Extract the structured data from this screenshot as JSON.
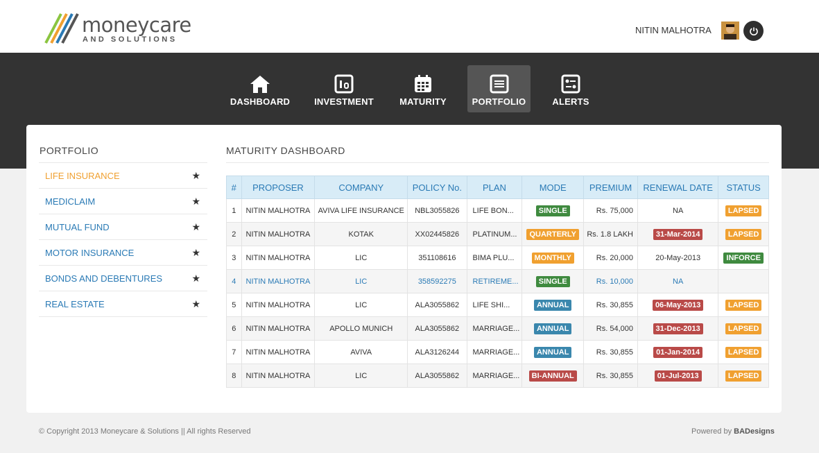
{
  "brand": {
    "name": "moneycare",
    "sub": "AND SOLUTIONS"
  },
  "user": {
    "name": "NITIN MALHOTRA"
  },
  "nav": [
    {
      "label": "DASHBOARD",
      "icon": "home-icon"
    },
    {
      "label": "INVESTMENT",
      "icon": "investment-icon"
    },
    {
      "label": "MATURITY",
      "icon": "calendar-icon"
    },
    {
      "label": "PORTFOLIO",
      "icon": "portfolio-icon",
      "active": true
    },
    {
      "label": "ALERTS",
      "icon": "alerts-icon"
    }
  ],
  "sidebar": {
    "title": "PORTFOLIO",
    "items": [
      {
        "label": "LIFE INSURANCE",
        "active": true
      },
      {
        "label": "MEDICLAIM"
      },
      {
        "label": "MUTUAL FUND"
      },
      {
        "label": "MOTOR INSURANCE"
      },
      {
        "label": "BONDS AND DEBENTURES"
      },
      {
        "label": "REAL ESTATE"
      }
    ]
  },
  "main": {
    "title": "MATURITY DASHBOARD",
    "columns": [
      "#",
      "PROPOSER",
      "COMPANY",
      "POLICY No.",
      "PLAN",
      "MODE",
      "PREMIUM",
      "RENEWAL DATE",
      "STATUS"
    ],
    "rows": [
      {
        "n": "1",
        "proposer": "NITIN MALHOTRA",
        "company": "AVIVA LIFE INSURANCE",
        "policy": "NBL3055826",
        "plan": "LIFE BON...",
        "mode": "SINGLE",
        "premium": "Rs. 75,000",
        "renewal": "NA",
        "status": "LAPSED"
      },
      {
        "n": "2",
        "proposer": "NITIN MALHOTRA",
        "company": "KOTAK",
        "policy": "XX02445826",
        "plan": "PLATINUM...",
        "mode": "QUARTERLY",
        "premium": "Rs. 1.8 LAKH",
        "renewal": "31-Mar-2014",
        "status": "LAPSED"
      },
      {
        "n": "3",
        "proposer": "NITIN MALHOTRA",
        "company": "LIC",
        "policy": "351108616",
        "plan": "BIMA PLU...",
        "mode": "MONTHLY",
        "premium": "Rs. 20,000",
        "renewal": "20-May-2013",
        "status": "INFORCE"
      },
      {
        "n": "4",
        "proposer": "NITIN MALHOTRA",
        "company": "LIC",
        "policy": "358592275",
        "plan": "RETIREME...",
        "mode": "SINGLE",
        "premium": "Rs. 10,000",
        "renewal": "NA",
        "status": ""
      },
      {
        "n": "5",
        "proposer": "NITIN MALHOTRA",
        "company": "LIC",
        "policy": "ALA3055862",
        "plan": "LIFE SHI...",
        "mode": "ANNUAL",
        "premium": "Rs. 30,855",
        "renewal": "06-May-2013",
        "status": "LAPSED"
      },
      {
        "n": "6",
        "proposer": "NITIN MALHOTRA",
        "company": "APOLLO MUNICH",
        "policy": "ALA3055862",
        "plan": "MARRIAGE...",
        "mode": "ANNUAL",
        "premium": "Rs. 54,000",
        "renewal": "31-Dec-2013",
        "status": "LAPSED"
      },
      {
        "n": "7",
        "proposer": "NITIN MALHOTRA",
        "company": "AVIVA",
        "policy": "ALA3126244",
        "plan": "MARRIAGE...",
        "mode": "ANNUAL",
        "premium": "Rs. 30,855",
        "renewal": "01-Jan-2014",
        "status": "LAPSED"
      },
      {
        "n": "8",
        "proposer": "NITIN MALHOTRA",
        "company": "LIC",
        "policy": "ALA3055862",
        "plan": "MARRIAGE...",
        "mode": "BI-ANNUAL",
        "premium": "Rs. 30,855",
        "renewal": "01-Jul-2013",
        "status": "LAPSED"
      }
    ]
  },
  "footer": {
    "copyright": "© Copyright 2013 Moneycare & Solutions || All rights Reserved",
    "powered_prefix": "Powered by ",
    "powered_brand": "BADesigns"
  },
  "colors": {
    "accent_orange": "#f0a030",
    "link_blue": "#2a7ab5",
    "dark_band": "#333333"
  }
}
